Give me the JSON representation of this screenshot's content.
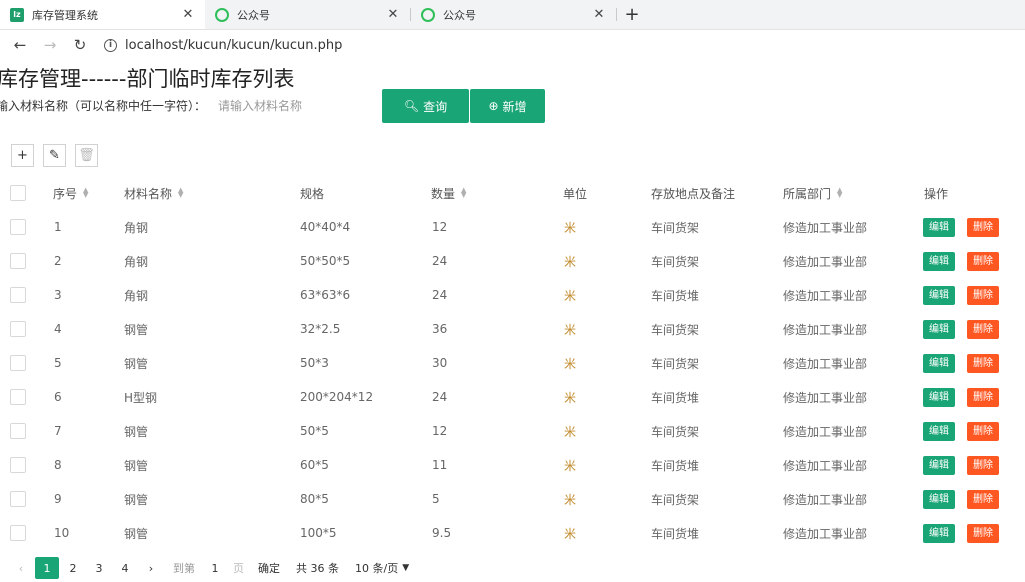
{
  "browser": {
    "tabs": [
      {
        "title": "库存管理系统",
        "icon": "lz-favicon",
        "active": true
      },
      {
        "title": "公众号",
        "icon": "wechat-favicon",
        "active": false
      },
      {
        "title": "公众号",
        "icon": "wechat-favicon",
        "active": false
      }
    ],
    "new_tab": "+",
    "url": "localhost/kucun/kucun/kucun.php"
  },
  "page": {
    "title": "库存管理------部门临时库存列表",
    "search_label": "输入材料名称（可以名称中任一字符）：",
    "search_placeholder": "请输入材料名称",
    "query_button": "查询",
    "add_button": "新增"
  },
  "table": {
    "columns": [
      "序号",
      "材料名称",
      "规格",
      "数量",
      "单位",
      "存放地点及备注",
      "所属部门",
      "操作"
    ],
    "edit_label": "编辑",
    "delete_label": "删除",
    "rows": [
      {
        "no": "1",
        "name": "角钢",
        "spec": "40*40*4",
        "qty": "12",
        "unit": "米",
        "location": "车间货架",
        "dept": "修造加工事业部"
      },
      {
        "no": "2",
        "name": "角钢",
        "spec": "50*50*5",
        "qty": "24",
        "unit": "米",
        "location": "车间货架",
        "dept": "修造加工事业部"
      },
      {
        "no": "3",
        "name": "角钢",
        "spec": "63*63*6",
        "qty": "24",
        "unit": "米",
        "location": "车间货堆",
        "dept": "修造加工事业部"
      },
      {
        "no": "4",
        "name": "钢管",
        "spec": "32*2.5",
        "qty": "36",
        "unit": "米",
        "location": "车间货架",
        "dept": "修造加工事业部"
      },
      {
        "no": "5",
        "name": "钢管",
        "spec": "50*3",
        "qty": "30",
        "unit": "米",
        "location": "车间货架",
        "dept": "修造加工事业部"
      },
      {
        "no": "6",
        "name": "H型钢",
        "spec": "200*204*12",
        "qty": "24",
        "unit": "米",
        "location": "车间货堆",
        "dept": "修造加工事业部"
      },
      {
        "no": "7",
        "name": "钢管",
        "spec": "50*5",
        "qty": "12",
        "unit": "米",
        "location": "车间货架",
        "dept": "修造加工事业部"
      },
      {
        "no": "8",
        "name": "钢管",
        "spec": "60*5",
        "qty": "11",
        "unit": "米",
        "location": "车间货堆",
        "dept": "修造加工事业部"
      },
      {
        "no": "9",
        "name": "钢管",
        "spec": "80*5",
        "qty": "5",
        "unit": "米",
        "location": "车间货架",
        "dept": "修造加工事业部"
      },
      {
        "no": "10",
        "name": "钢管",
        "spec": "100*5",
        "qty": "9.5",
        "unit": "米",
        "location": "车间货堆",
        "dept": "修造加工事业部"
      }
    ]
  },
  "pager": {
    "pages": [
      "1",
      "2",
      "3",
      "4"
    ],
    "current": "1",
    "jump_label": "到第",
    "jump_value": "1",
    "page_unit": "页",
    "confirm": "确定",
    "total": "共 36 条",
    "page_size": "10 条/页"
  },
  "colors": {
    "accent": "#1aa577",
    "danger": "#ff5722"
  }
}
